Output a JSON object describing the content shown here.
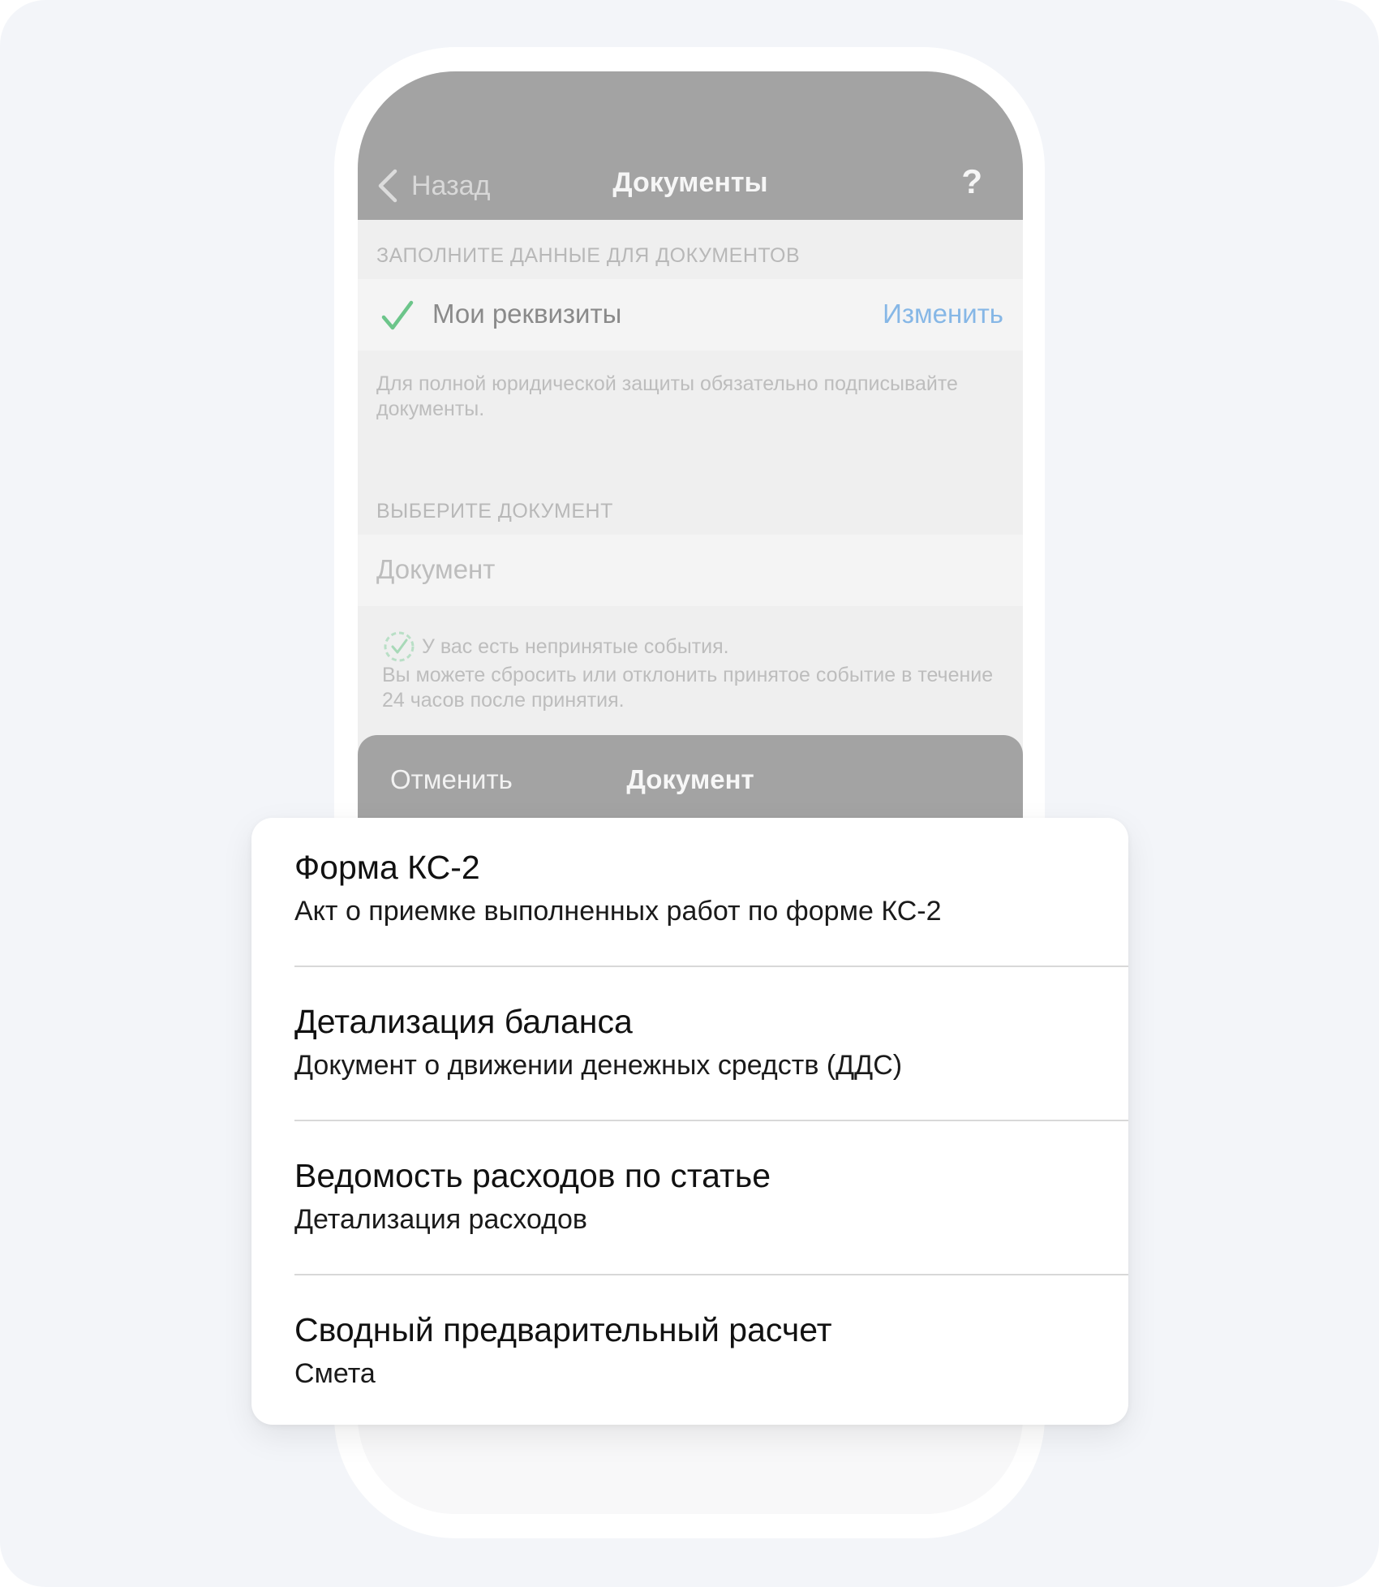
{
  "nav": {
    "back_label": "Назад",
    "title": "Документы",
    "help_label": "?"
  },
  "requisites": {
    "section_header": "ЗАПОЛНИТЕ ДАННЫЕ ДЛЯ ДОКУМЕНТОВ",
    "label": "Мои реквизиты",
    "action": "Изменить",
    "note": "Для полной юридической защиты обязательно подписывайте документы."
  },
  "document": {
    "section_header": "ВЫБЕРИТЕ ДОКУМЕНТ",
    "placeholder": "Документ"
  },
  "events": {
    "title": "У вас есть непринятые события.",
    "description": "Вы можете сбросить или отклонить принятое событие в течение 24 часов после принятия."
  },
  "picker": {
    "cancel_label": "Отменить",
    "title": "Документ"
  },
  "options": [
    {
      "title": "Форма КС-2",
      "subtitle": "Акт о приемке выполненных работ по форме КС-2"
    },
    {
      "title": "Детализация баланса",
      "subtitle": "Документ о движении денежных средств (ДДС)"
    },
    {
      "title": "Ведомость расходов по статье",
      "subtitle": "Детализация расходов"
    },
    {
      "title": "Сводный предварительный расчет",
      "subtitle": "Смета"
    }
  ],
  "colors": {
    "accent_link": "#86b7e6",
    "check_green": "#6cc58a",
    "nav_overlay": "#a3a3a3"
  },
  "icons": {
    "back": "chevron-left-icon",
    "requisites_status": "checkmark-icon",
    "events_status": "dashed-circle-check-icon"
  }
}
